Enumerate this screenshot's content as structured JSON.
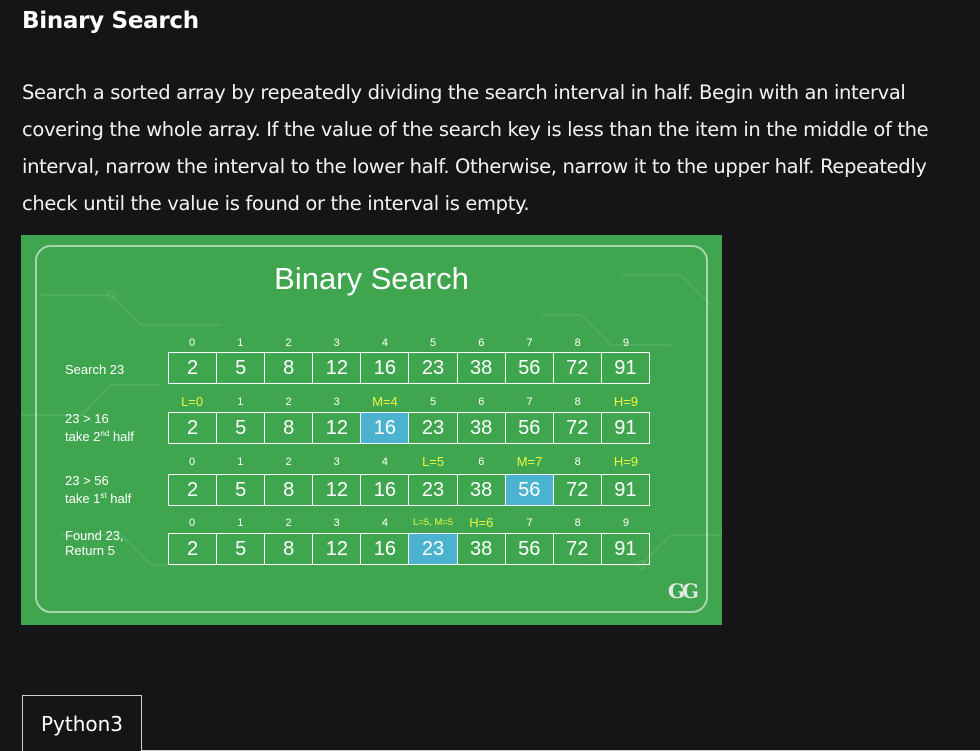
{
  "page": {
    "title": "Binary Search",
    "description": "Search a sorted array by repeatedly dividing the search interval in half. Begin with an interval covering the whole array. If the value of the search key is less than the item in the middle of the interval, narrow the interval to the lower half. Otherwise, narrow it to the upper half. Repeatedly check until the value is found or the interval is empty."
  },
  "figure": {
    "title": "Binary Search",
    "logo": "GG",
    "colors": {
      "background": "#3fa64f",
      "highlight": "#4bb3cf",
      "pointer_text": "#e8f545"
    },
    "steps": [
      {
        "label_lines": [
          "Search 23"
        ],
        "indices": [
          "0",
          "1",
          "2",
          "3",
          "4",
          "5",
          "6",
          "7",
          "8",
          "9"
        ],
        "values": [
          "2",
          "5",
          "8",
          "12",
          "16",
          "23",
          "38",
          "56",
          "72",
          "91"
        ],
        "highlight_index": null
      },
      {
        "label_lines": [
          "23 > 16",
          "take 2nd half"
        ],
        "indices": [
          "L=0",
          "1",
          "2",
          "3",
          "M=4",
          "5",
          "6",
          "7",
          "8",
          "H=9"
        ],
        "values": [
          "2",
          "5",
          "8",
          "12",
          "16",
          "23",
          "38",
          "56",
          "72",
          "91"
        ],
        "highlight_index": 4
      },
      {
        "label_lines": [
          "23 > 56",
          "take 1st half"
        ],
        "indices": [
          "0",
          "1",
          "2",
          "3",
          "4",
          "L=5",
          "6",
          "M=7",
          "8",
          "H=9"
        ],
        "values": [
          "2",
          "5",
          "8",
          "12",
          "16",
          "23",
          "38",
          "56",
          "72",
          "91"
        ],
        "highlight_index": 7
      },
      {
        "label_lines": [
          "Found 23,",
          "Return 5"
        ],
        "indices": [
          "0",
          "1",
          "2",
          "3",
          "4",
          "L=5, M=5",
          "H=6",
          "7",
          "8",
          "9"
        ],
        "values": [
          "2",
          "5",
          "8",
          "12",
          "16",
          "23",
          "38",
          "56",
          "72",
          "91"
        ],
        "highlight_index": 5
      }
    ]
  },
  "tabs": {
    "active_language": "Python3"
  }
}
